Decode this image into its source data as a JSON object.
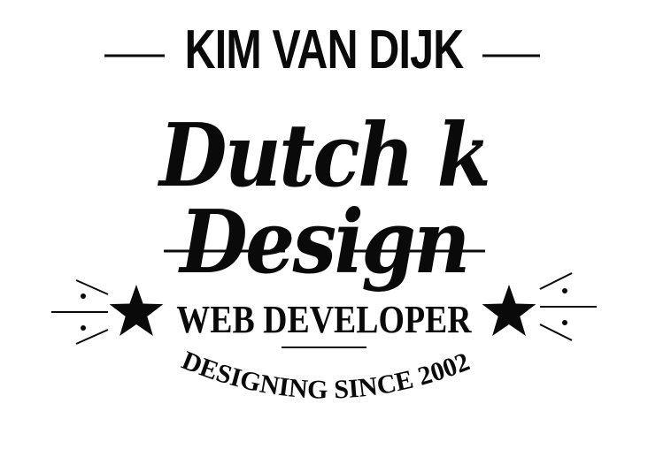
{
  "logo": {
    "name": "KIM VAN DIJK",
    "brand": "Dutch k Design",
    "role": "WEB DEVELOPER",
    "tagline": "DESIGNING SINCE 2002",
    "ink_color": "#0a0a0a",
    "background_color": "#ffffff",
    "decorations": [
      "star-icon",
      "star-icon",
      "burst-lines-icon",
      "burst-lines-icon"
    ]
  }
}
